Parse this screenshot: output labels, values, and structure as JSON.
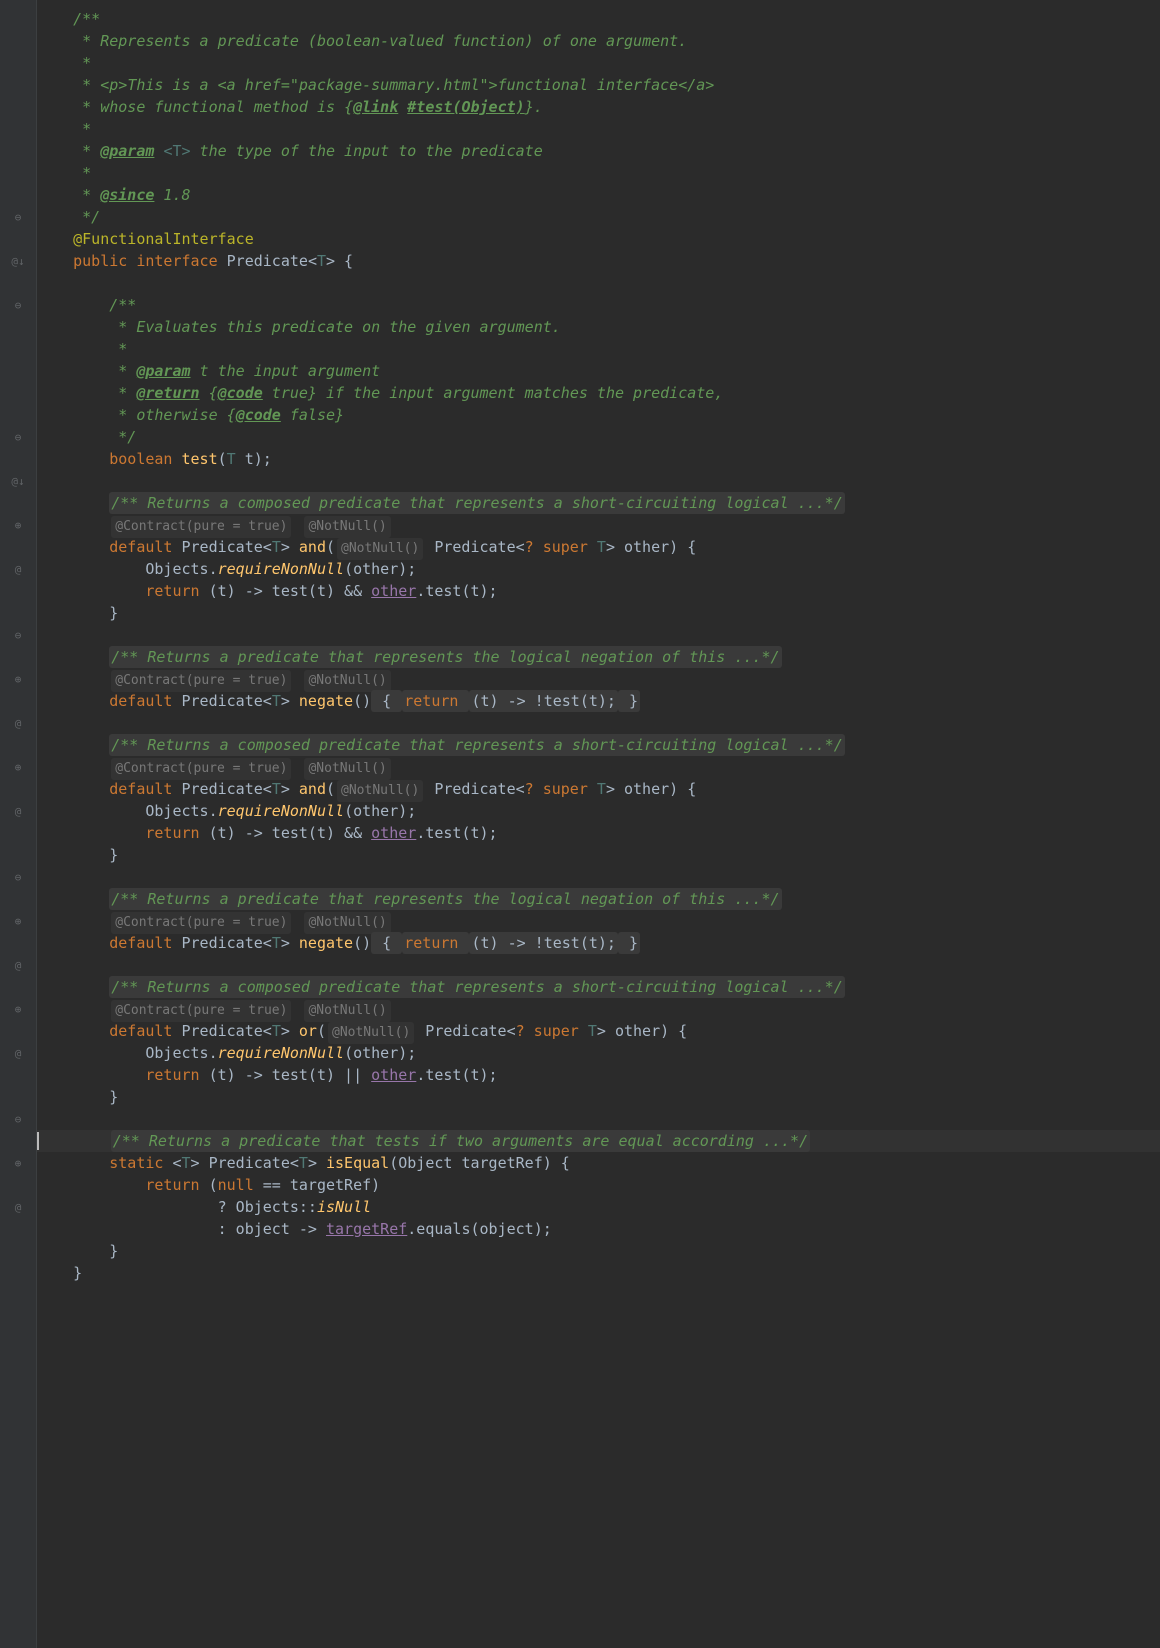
{
  "gutter": {
    "markers": [
      "",
      "",
      "",
      "",
      "",
      "",
      "",
      "",
      "",
      "⊖",
      "",
      "@↓",
      "",
      "⊖",
      "",
      "",
      "",
      "",
      "",
      "⊖",
      "",
      "@↓",
      "",
      "⊕",
      "",
      "@",
      "",
      "",
      "⊖",
      "",
      "⊕",
      "",
      "@",
      "",
      "⊕",
      "",
      "@",
      "",
      "",
      "⊖",
      "",
      "⊕",
      "",
      "@",
      "",
      "⊕",
      "",
      "@",
      "",
      "",
      "⊖",
      "",
      "⊕",
      "",
      "@",
      "",
      "",
      "",
      "⊖",
      ""
    ]
  },
  "lines": [
    {
      "seg": [
        {
          "c": "c-doc",
          "t": "/**"
        }
      ],
      "i": 1
    },
    {
      "seg": [
        {
          "c": "c-doc",
          "t": " * Represents a predicate (boolean-valued function) of one argument."
        }
      ],
      "i": 1
    },
    {
      "seg": [
        {
          "c": "c-doc",
          "t": " *"
        }
      ],
      "i": 1
    },
    {
      "seg": [
        {
          "c": "c-doc",
          "t": " * <p>"
        },
        {
          "c": "c-doc",
          "t": "This is a "
        },
        {
          "c": "c-doc",
          "t": "<a href=\"package-summary.html\">"
        },
        {
          "c": "c-doc",
          "t": "functional interface"
        },
        {
          "c": "c-doc",
          "t": "</a>"
        }
      ],
      "i": 1
    },
    {
      "seg": [
        {
          "c": "c-doc",
          "t": " * whose functional method is "
        },
        {
          "c": "c-doc",
          "t": "{"
        },
        {
          "c": "c-doclink",
          "t": "@link"
        },
        {
          "c": "c-doc",
          "t": " "
        },
        {
          "c": "c-doclink",
          "t": "#test(Object)"
        },
        {
          "c": "c-doc",
          "t": "}"
        },
        {
          "c": "c-doc",
          "t": "."
        }
      ],
      "i": 1
    },
    {
      "seg": [
        {
          "c": "c-doc",
          "t": " *"
        }
      ],
      "i": 1
    },
    {
      "seg": [
        {
          "c": "c-doc",
          "t": " * "
        },
        {
          "c": "c-doctag",
          "t": "@param"
        },
        {
          "c": "c-doc",
          "t": " "
        },
        {
          "c": "c-typeparam",
          "t": "<T>"
        },
        {
          "c": "c-doc",
          "t": " the type of the input to the predicate"
        }
      ],
      "i": 1
    },
    {
      "seg": [
        {
          "c": "c-doc",
          "t": " *"
        }
      ],
      "i": 1
    },
    {
      "seg": [
        {
          "c": "c-doc",
          "t": " * "
        },
        {
          "c": "c-doctag",
          "t": "@since"
        },
        {
          "c": "c-doc",
          "t": " 1.8"
        }
      ],
      "i": 1
    },
    {
      "seg": [
        {
          "c": "c-doc",
          "t": " */"
        }
      ],
      "i": 1
    },
    {
      "seg": [
        {
          "c": "c-annot",
          "t": "@FunctionalInterface"
        }
      ],
      "i": 1
    },
    {
      "seg": [
        {
          "c": "c-keyword",
          "t": "public interface "
        },
        {
          "c": "c-classname",
          "t": "Predicate"
        },
        {
          "c": "c-plain",
          "t": "<"
        },
        {
          "c": "c-typeparam",
          "t": "T"
        },
        {
          "c": "c-plain",
          "t": "> {"
        }
      ],
      "i": 1
    },
    {
      "seg": [],
      "i": 1
    },
    {
      "seg": [
        {
          "c": "c-doc",
          "t": "/**"
        }
      ],
      "i": 2
    },
    {
      "seg": [
        {
          "c": "c-doc",
          "t": " * Evaluates this predicate on the given argument."
        }
      ],
      "i": 2
    },
    {
      "seg": [
        {
          "c": "c-doc",
          "t": " *"
        }
      ],
      "i": 2
    },
    {
      "seg": [
        {
          "c": "c-doc",
          "t": " * "
        },
        {
          "c": "c-doctag",
          "t": "@param"
        },
        {
          "c": "c-doc",
          "t": " t the input argument"
        }
      ],
      "i": 2
    },
    {
      "seg": [
        {
          "c": "c-doc",
          "t": " * "
        },
        {
          "c": "c-doctag",
          "t": "@return"
        },
        {
          "c": "c-doc",
          "t": " {"
        },
        {
          "c": "c-doclink",
          "t": "@code"
        },
        {
          "c": "c-doc",
          "t": " true} if the input argument matches the predicate,"
        }
      ],
      "i": 2
    },
    {
      "seg": [
        {
          "c": "c-doc",
          "t": " * otherwise {"
        },
        {
          "c": "c-doclink",
          "t": "@code"
        },
        {
          "c": "c-doc",
          "t": " false}"
        }
      ],
      "i": 2
    },
    {
      "seg": [
        {
          "c": "c-doc",
          "t": " */"
        }
      ],
      "i": 2
    },
    {
      "seg": [
        {
          "c": "c-keyword",
          "t": "boolean "
        },
        {
          "c": "c-method",
          "t": "test"
        },
        {
          "c": "c-plain",
          "t": "("
        },
        {
          "c": "c-typeparam",
          "t": "T"
        },
        {
          "c": "c-plain",
          "t": " t);"
        }
      ],
      "i": 2
    },
    {
      "seg": [],
      "i": 1
    },
    {
      "seg": [
        {
          "f": 1,
          "c": "c-doc",
          "t": "/** Returns a composed predicate that represents a short-circuiting logical ...*/"
        }
      ],
      "i": 2
    },
    {
      "seg": [
        {
          "y": 1,
          "t": "@Contract(pure = true)"
        },
        {
          "t": " "
        },
        {
          "y": 1,
          "t": "@NotNull()"
        }
      ],
      "i": 2
    },
    {
      "seg": [
        {
          "c": "c-keyword",
          "t": "default "
        },
        {
          "c": "c-classname",
          "t": "Predicate"
        },
        {
          "c": "c-plain",
          "t": "<"
        },
        {
          "c": "c-typeparam",
          "t": "T"
        },
        {
          "c": "c-plain",
          "t": "> "
        },
        {
          "c": "c-method",
          "t": "and"
        },
        {
          "c": "c-plain",
          "t": "("
        },
        {
          "y": 1,
          "t": "@NotNull()"
        },
        {
          "c": "c-plain",
          "t": " Predicate<"
        },
        {
          "c": "c-keyword",
          "t": "? super "
        },
        {
          "c": "c-typeparam",
          "t": "T"
        },
        {
          "c": "c-plain",
          "t": "> other) {"
        }
      ],
      "i": 2
    },
    {
      "seg": [
        {
          "c": "c-plain",
          "t": "Objects."
        },
        {
          "c": "c-method c-static",
          "t": "requireNonNull"
        },
        {
          "c": "c-plain",
          "t": "(other);"
        }
      ],
      "i": 3
    },
    {
      "seg": [
        {
          "c": "c-keyword",
          "t": "return "
        },
        {
          "c": "c-plain",
          "t": "(t) -> test(t) && "
        },
        {
          "c": "c-ident",
          "t": "other"
        },
        {
          "c": "c-plain",
          "t": ".test(t);"
        }
      ],
      "i": 3
    },
    {
      "seg": [
        {
          "c": "c-plain",
          "t": "}"
        }
      ],
      "i": 2
    },
    {
      "seg": [],
      "i": 1
    },
    {
      "seg": [
        {
          "f": 1,
          "c": "c-doc",
          "t": "/** Returns a predicate that represents the logical negation of this ...*/"
        }
      ],
      "i": 2
    },
    {
      "seg": [
        {
          "y": 1,
          "t": "@Contract(pure = true)"
        },
        {
          "t": " "
        },
        {
          "y": 1,
          "t": "@NotNull()"
        }
      ],
      "i": 2
    },
    {
      "seg": [
        {
          "c": "c-keyword",
          "t": "default "
        },
        {
          "c": "c-classname",
          "t": "Predicate"
        },
        {
          "c": "c-plain",
          "t": "<"
        },
        {
          "c": "c-typeparam",
          "t": "T"
        },
        {
          "c": "c-plain",
          "t": "> "
        },
        {
          "c": "c-method",
          "t": "negate"
        },
        {
          "c": "c-plain",
          "t": "()"
        },
        {
          "f": 1,
          "t": " { "
        },
        {
          "f": 1,
          "c": "c-keyword",
          "t": "return "
        },
        {
          "f": 1,
          "c": "c-plain",
          "t": "(t) -> !test(t);"
        },
        {
          "f": 1,
          "t": " }"
        }
      ],
      "i": 2
    },
    {
      "seg": [],
      "i": 1
    },
    {
      "seg": [
        {
          "f": 1,
          "c": "c-doc",
          "t": "/** Returns a composed predicate that represents a short-circuiting logical ...*/"
        }
      ],
      "i": 2
    },
    {
      "seg": [
        {
          "y": 1,
          "t": "@Contract(pure = true)"
        },
        {
          "t": " "
        },
        {
          "y": 1,
          "t": "@NotNull()"
        }
      ],
      "i": 2
    },
    {
      "seg": [
        {
          "c": "c-keyword",
          "t": "default "
        },
        {
          "c": "c-classname",
          "t": "Predicate"
        },
        {
          "c": "c-plain",
          "t": "<"
        },
        {
          "c": "c-typeparam",
          "t": "T"
        },
        {
          "c": "c-plain",
          "t": "> "
        },
        {
          "c": "c-method",
          "t": "and"
        },
        {
          "c": "c-plain",
          "t": "("
        },
        {
          "y": 1,
          "t": "@NotNull()"
        },
        {
          "c": "c-plain",
          "t": " Predicate<"
        },
        {
          "c": "c-keyword",
          "t": "? super "
        },
        {
          "c": "c-typeparam",
          "t": "T"
        },
        {
          "c": "c-plain",
          "t": "> other) {"
        }
      ],
      "i": 2
    },
    {
      "seg": [
        {
          "c": "c-plain",
          "t": "Objects."
        },
        {
          "c": "c-method c-static",
          "t": "requireNonNull"
        },
        {
          "c": "c-plain",
          "t": "(other);"
        }
      ],
      "i": 3
    },
    {
      "seg": [
        {
          "c": "c-keyword",
          "t": "return "
        },
        {
          "c": "c-plain",
          "t": "(t) -> test(t) && "
        },
        {
          "c": "c-ident",
          "t": "other"
        },
        {
          "c": "c-plain",
          "t": ".test(t);"
        }
      ],
      "i": 3
    },
    {
      "seg": [
        {
          "c": "c-plain",
          "t": "}"
        }
      ],
      "i": 2
    },
    {
      "seg": [],
      "i": 1
    },
    {
      "seg": [
        {
          "f": 1,
          "c": "c-doc",
          "t": "/** Returns a predicate that represents the logical negation of this ...*/"
        }
      ],
      "i": 2
    },
    {
      "seg": [
        {
          "y": 1,
          "t": "@Contract(pure = true)"
        },
        {
          "t": " "
        },
        {
          "y": 1,
          "t": "@NotNull()"
        }
      ],
      "i": 2
    },
    {
      "seg": [
        {
          "c": "c-keyword",
          "t": "default "
        },
        {
          "c": "c-classname",
          "t": "Predicate"
        },
        {
          "c": "c-plain",
          "t": "<"
        },
        {
          "c": "c-typeparam",
          "t": "T"
        },
        {
          "c": "c-plain",
          "t": "> "
        },
        {
          "c": "c-method",
          "t": "negate"
        },
        {
          "c": "c-plain",
          "t": "()"
        },
        {
          "f": 1,
          "t": " { "
        },
        {
          "f": 1,
          "c": "c-keyword",
          "t": "return "
        },
        {
          "f": 1,
          "c": "c-plain",
          "t": "(t) -> !test(t);"
        },
        {
          "f": 1,
          "t": " }"
        }
      ],
      "i": 2
    },
    {
      "seg": [],
      "i": 1
    },
    {
      "seg": [
        {
          "f": 1,
          "c": "c-doc",
          "t": "/** Returns a composed predicate that represents a short-circuiting logical ...*/"
        }
      ],
      "i": 2
    },
    {
      "seg": [
        {
          "y": 1,
          "t": "@Contract(pure = true)"
        },
        {
          "t": " "
        },
        {
          "y": 1,
          "t": "@NotNull()"
        }
      ],
      "i": 2
    },
    {
      "seg": [
        {
          "c": "c-keyword",
          "t": "default "
        },
        {
          "c": "c-classname",
          "t": "Predicate"
        },
        {
          "c": "c-plain",
          "t": "<"
        },
        {
          "c": "c-typeparam",
          "t": "T"
        },
        {
          "c": "c-plain",
          "t": "> "
        },
        {
          "c": "c-method",
          "t": "or"
        },
        {
          "c": "c-plain",
          "t": "("
        },
        {
          "y": 1,
          "t": "@NotNull()"
        },
        {
          "c": "c-plain",
          "t": " Predicate<"
        },
        {
          "c": "c-keyword",
          "t": "? super "
        },
        {
          "c": "c-typeparam",
          "t": "T"
        },
        {
          "c": "c-plain",
          "t": "> other) {"
        }
      ],
      "i": 2
    },
    {
      "seg": [
        {
          "c": "c-plain",
          "t": "Objects."
        },
        {
          "c": "c-method c-static",
          "t": "requireNonNull"
        },
        {
          "c": "c-plain",
          "t": "(other);"
        }
      ],
      "i": 3
    },
    {
      "seg": [
        {
          "c": "c-keyword",
          "t": "return "
        },
        {
          "c": "c-plain",
          "t": "(t) -> test(t) || "
        },
        {
          "c": "c-ident",
          "t": "other"
        },
        {
          "c": "c-plain",
          "t": ".test(t);"
        }
      ],
      "i": 3
    },
    {
      "seg": [
        {
          "c": "c-plain",
          "t": "}"
        }
      ],
      "i": 2
    },
    {
      "seg": [],
      "i": 1
    },
    {
      "cursor": 1,
      "seg": [
        {
          "f": 1,
          "c": "c-doc",
          "t": "/** Returns a predicate that tests if two arguments are equal according ...*/"
        }
      ],
      "i": 2
    },
    {
      "seg": [
        {
          "c": "c-keyword",
          "t": "static "
        },
        {
          "c": "c-plain",
          "t": "<"
        },
        {
          "c": "c-typeparam",
          "t": "T"
        },
        {
          "c": "c-plain",
          "t": "> Predicate<"
        },
        {
          "c": "c-typeparam",
          "t": "T"
        },
        {
          "c": "c-plain",
          "t": "> "
        },
        {
          "c": "c-method",
          "t": "isEqual"
        },
        {
          "c": "c-plain",
          "t": "(Object targetRef) {"
        }
      ],
      "i": 2
    },
    {
      "seg": [
        {
          "c": "c-keyword",
          "t": "return "
        },
        {
          "c": "c-plain",
          "t": "("
        },
        {
          "c": "c-keyword",
          "t": "null "
        },
        {
          "c": "c-plain",
          "t": "== targetRef)"
        }
      ],
      "i": 3
    },
    {
      "seg": [
        {
          "c": "c-plain",
          "t": "? Objects::"
        },
        {
          "c": "c-method c-static",
          "t": "isNull"
        }
      ],
      "i": 5
    },
    {
      "seg": [
        {
          "c": "c-plain",
          "t": ": object -> "
        },
        {
          "c": "c-ident",
          "t": "targetRef"
        },
        {
          "c": "c-plain",
          "t": ".equals(object);"
        }
      ],
      "i": 5
    },
    {
      "seg": [
        {
          "c": "c-plain",
          "t": "}"
        }
      ],
      "i": 2
    },
    {
      "seg": [
        {
          "c": "c-plain",
          "t": "}"
        }
      ],
      "i": 1
    }
  ]
}
